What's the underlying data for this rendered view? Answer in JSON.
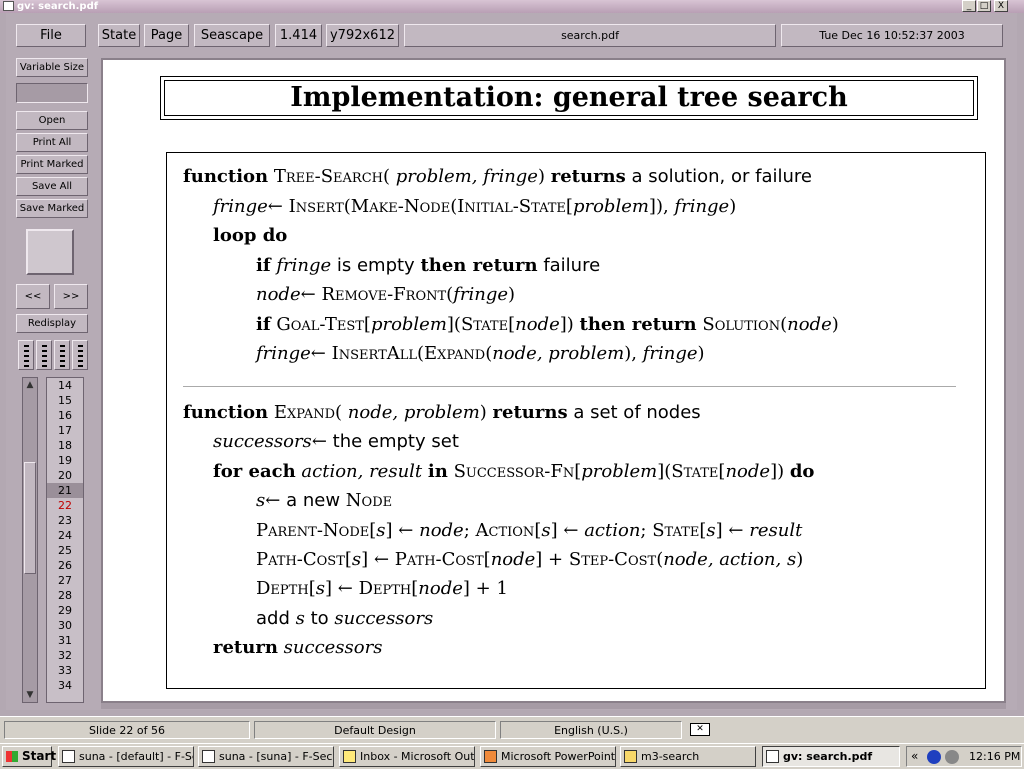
{
  "window": {
    "title": "gv: search.pdf",
    "min": "_",
    "max": "□",
    "close": "X"
  },
  "toolbar": {
    "file": "File",
    "state": "State",
    "page": "Page",
    "orientation": "Seascape",
    "scale": "1.414",
    "size": "y792x612",
    "filename": "search.pdf",
    "datetime": "Tue Dec 16 10:52:37 2003"
  },
  "sidebar": {
    "variable_size": "Variable Size",
    "open": "Open",
    "print_all": "Print All",
    "print_marked": "Print Marked",
    "save_all": "Save All",
    "save_marked": "Save Marked",
    "prev": "<<",
    "next": ">>",
    "redisplay": "Redisplay",
    "pages": [
      "14",
      "15",
      "16",
      "17",
      "18",
      "19",
      "20",
      "21",
      "22",
      "23",
      "24",
      "25",
      "26",
      "27",
      "28",
      "29",
      "30",
      "31",
      "32",
      "33",
      "34"
    ],
    "highlighted_page": "21",
    "current_page": "22"
  },
  "slide": {
    "title": "Implementation: general tree search",
    "tree_search": {
      "l1": {
        "a": "function",
        "b": "Tree-Search",
        "c": "(",
        "d": "problem, fringe",
        "e": ")",
        "f": "returns",
        "g": "a solution, or failure"
      },
      "l2": {
        "a": "fringe",
        "b": "←",
        "c": "Insert",
        "d": "(",
        "e": "Make-Node",
        "f": "(",
        "g": "Initial-State",
        "h": "[",
        "i": "problem",
        "j": "]), ",
        "k": "fringe",
        "l": ")"
      },
      "l3": {
        "a": "loop do"
      },
      "l4": {
        "a": "if",
        "b": "fringe",
        "c": "is empty",
        "d": "then return",
        "e": "failure"
      },
      "l5": {
        "a": "node",
        "b": "←",
        "c": "Remove-Front",
        "d": "(",
        "e": "fringe",
        "f": ")"
      },
      "l6": {
        "a": "if",
        "b": "Goal-Test",
        "c": "[",
        "d": "problem",
        "e": "](",
        "f": "State",
        "g": "[",
        "h": "node",
        "i": "])",
        "j": "then return",
        "k": "Solution",
        "l": "(",
        "m": "node",
        "n": ")"
      },
      "l7": {
        "a": "fringe",
        "b": "←",
        "c": "InsertAll",
        "d": "(",
        "e": "Expand",
        "f": "(",
        "g": "node, problem",
        "h": "), ",
        "i": "fringe",
        "j": ")"
      }
    },
    "expand": {
      "l1": {
        "a": "function",
        "b": "Expand",
        "c": "(",
        "d": "node, problem",
        "e": ")",
        "f": "returns",
        "g": "a set of nodes"
      },
      "l2": {
        "a": "successors",
        "b": "←",
        "c": "the empty set"
      },
      "l3": {
        "a": "for each",
        "b": "action, result",
        "c": "in",
        "d": "Successor-Fn",
        "e": "[",
        "f": "problem",
        "g": "](",
        "h": "State",
        "i": "[",
        "j": "node",
        "k": "])",
        "l": "do"
      },
      "l4": {
        "a": "s",
        "b": "←",
        "c": "a new",
        "d": "Node"
      },
      "l5": {
        "a": "Parent-Node",
        "b": "[",
        "c": "s",
        "d": "]",
        "e": "←",
        "f": "node",
        "g": ";   ",
        "h": "Action",
        "i": "[",
        "j": "s",
        "k": "]",
        "l": "←",
        "m": "action",
        "n": ";   ",
        "o": "State",
        "p": "[",
        "q": "s",
        "r": "]",
        "s": "←",
        "t": "result"
      },
      "l6": {
        "a": "Path-Cost",
        "b": "[",
        "c": "s",
        "d": "]",
        "e": "←",
        "f": "Path-Cost",
        "g": "[",
        "h": "node",
        "i": "] + ",
        "j": "Step-Cost",
        "k": "(",
        "l": "node, action, s",
        "m": ")"
      },
      "l7": {
        "a": "Depth",
        "b": "[",
        "c": "s",
        "d": "]",
        "e": "←",
        "f": "Depth",
        "g": "[",
        "h": "node",
        "i": "] + 1"
      },
      "l8": {
        "a": "add",
        "b": "s",
        "c": "to",
        "d": "successors"
      },
      "l9": {
        "a": "return",
        "b": "successors"
      }
    }
  },
  "statusbar": {
    "slide": "Slide 22 of 56",
    "design": "Default Design",
    "language": "English (U.S.)"
  },
  "taskbar": {
    "start": "Start",
    "tasks": [
      "suna - [default] - F-Se...",
      "suna - [suna] - F-Sec...",
      "Inbox - Microsoft Outl...",
      "Microsoft PowerPoint...",
      "m3-search",
      "gv: search.pdf"
    ],
    "tray_chevron": "«",
    "clock": "12:16 PM"
  }
}
